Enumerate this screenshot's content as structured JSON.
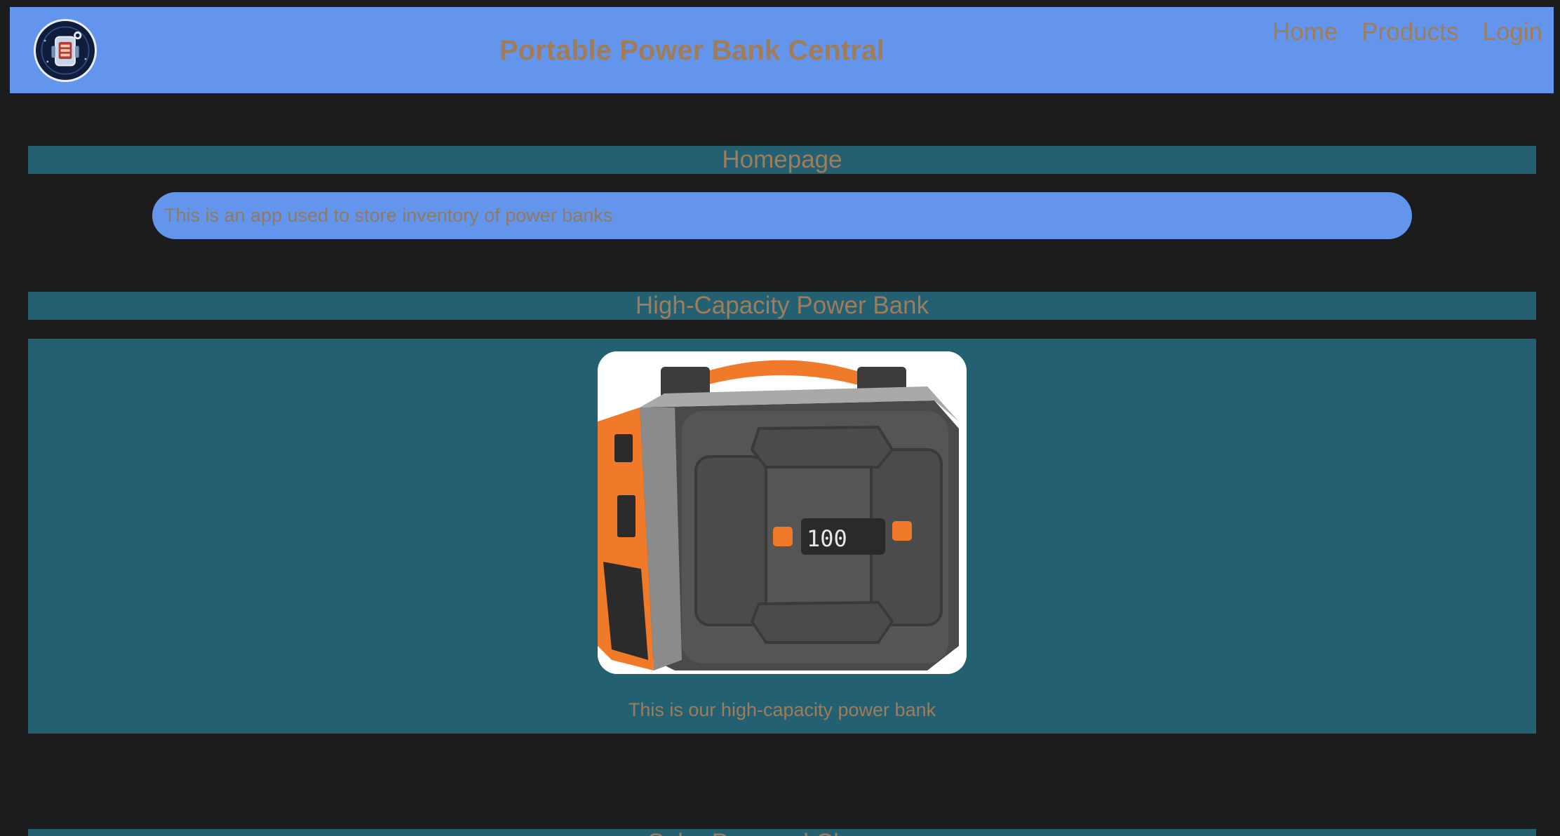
{
  "header": {
    "logo_icon": "robot-power-bank-logo-icon",
    "title": "Portable Power Bank Central",
    "nav": [
      {
        "label": "Home"
      },
      {
        "label": "Products"
      },
      {
        "label": "Login"
      }
    ]
  },
  "homepage": {
    "heading": "Homepage",
    "description": "This is an app used to store inventory of power banks"
  },
  "product": {
    "heading": "High-Capacity Power Bank",
    "image_icon": "portable-power-station-image",
    "display_readout": "100",
    "caption": "This is our high-capacity power bank"
  },
  "next_section": {
    "heading": "Solar Powered Chargers"
  },
  "colors": {
    "background": "#1c1c1c",
    "header": "#6495ed",
    "section": "#226072",
    "text": "#a07c58",
    "accent_orange": "#f07a2a"
  }
}
